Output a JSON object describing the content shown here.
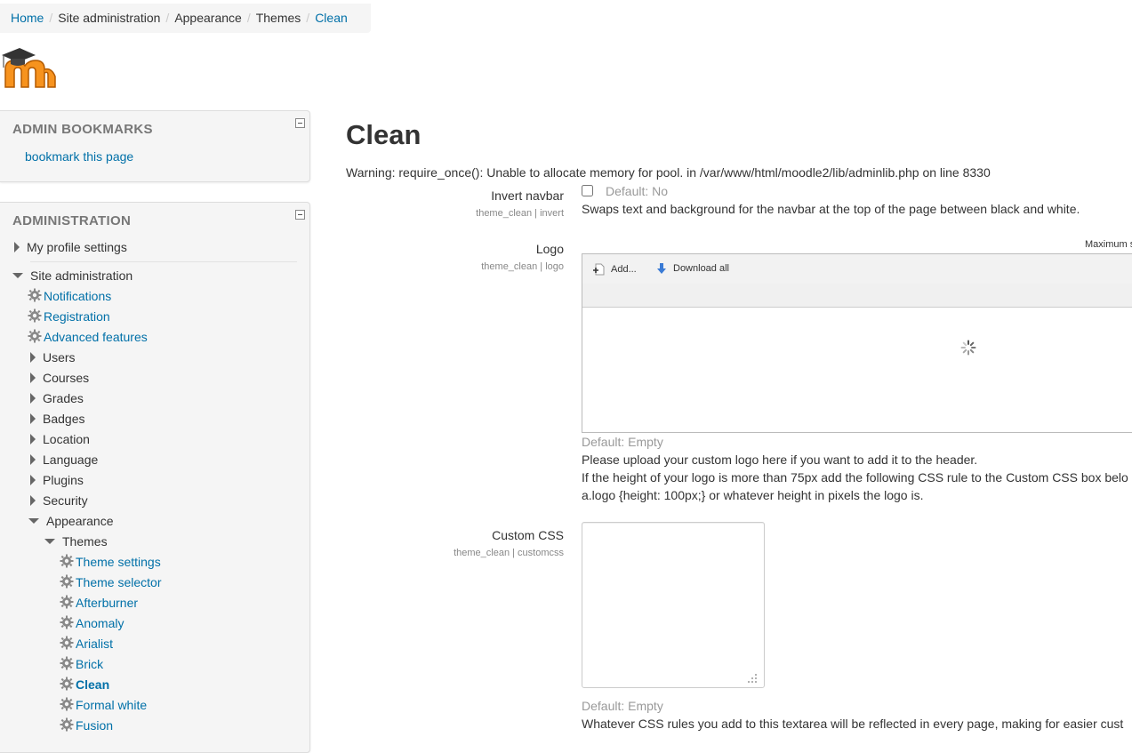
{
  "breadcrumb": {
    "home": "Home",
    "site_admin": "Site administration",
    "appearance": "Appearance",
    "themes": "Themes",
    "current": "Clean"
  },
  "admin_bookmarks": {
    "title": "ADMIN BOOKMARKS",
    "link": "bookmark this page"
  },
  "administration": {
    "title": "ADMINISTRATION",
    "my_profile": "My profile settings",
    "site_admin": "Site administration",
    "items": [
      {
        "label": "Notifications",
        "type": "gear"
      },
      {
        "label": "Registration",
        "type": "gear"
      },
      {
        "label": "Advanced features",
        "type": "gear"
      },
      {
        "label": "Users",
        "type": "folder"
      },
      {
        "label": "Courses",
        "type": "folder"
      },
      {
        "label": "Grades",
        "type": "folder"
      },
      {
        "label": "Badges",
        "type": "folder"
      },
      {
        "label": "Location",
        "type": "folder"
      },
      {
        "label": "Language",
        "type": "folder"
      },
      {
        "label": "Plugins",
        "type": "folder"
      },
      {
        "label": "Security",
        "type": "folder"
      },
      {
        "label": "Appearance",
        "type": "open"
      }
    ],
    "themes": "Themes",
    "theme_items": [
      {
        "label": "Theme settings",
        "active": false
      },
      {
        "label": "Theme selector",
        "active": false
      },
      {
        "label": "Afterburner",
        "active": false
      },
      {
        "label": "Anomaly",
        "active": false
      },
      {
        "label": "Arialist",
        "active": false
      },
      {
        "label": "Brick",
        "active": false
      },
      {
        "label": "Clean",
        "active": true
      },
      {
        "label": "Formal white",
        "active": false
      },
      {
        "label": "Fusion",
        "active": false
      }
    ]
  },
  "main": {
    "title": "Clean",
    "warning": "Warning: require_once(): Unable to allocate memory for pool. in /var/www/html/moodle2/lib/adminlib.php on line 8330",
    "invert_navbar": {
      "label": "Invert navbar",
      "id": "theme_clean | invert",
      "default": "Default: No",
      "checked": false,
      "description": "Swaps text and background for the navbar at the top of the page between black and white."
    },
    "logo": {
      "label": "Logo",
      "id": "theme_clean | logo",
      "max_size": "Maximum s",
      "add_label": "Add...",
      "download_label": "Download all",
      "default": "Default: Empty",
      "desc1": "Please upload your custom logo here if you want to add it to the header.",
      "desc2": "If the height of your logo is more than 75px add the following CSS rule to the Custom CSS box belo",
      "desc3": "a.logo {height: 100px;} or whatever height in pixels the logo is."
    },
    "custom_css": {
      "label": "Custom CSS",
      "id": "theme_clean | customcss",
      "value": "",
      "default": "Default: Empty",
      "description": "Whatever CSS rules you add to this textarea will be reflected in every page, making for easier cust"
    }
  },
  "colors": {
    "link": "#0070a8",
    "text": "#333333",
    "muted": "#999999",
    "block_bg": "#f5f5f5",
    "logo_orange": "#f7931e"
  }
}
